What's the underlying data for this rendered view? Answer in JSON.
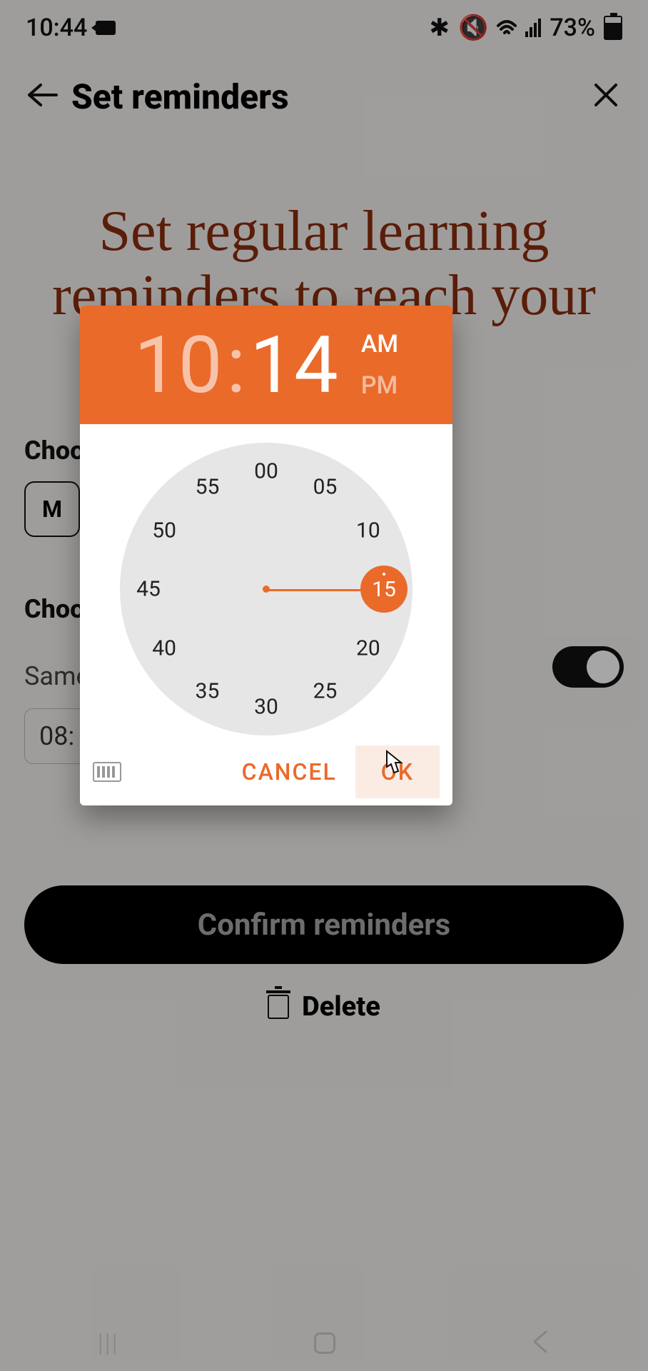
{
  "status": {
    "time": "10:44",
    "battery": "73%"
  },
  "appbar": {
    "title": "Set reminders"
  },
  "hero": "Set regular learning reminders to reach your",
  "form": {
    "chooseDays": "Choo",
    "dayChip": "M",
    "chooseTime": "Choo",
    "sameTime": "Same",
    "timeValue": "08:"
  },
  "buttons": {
    "confirm": "Confirm reminders",
    "delete": "Delete"
  },
  "picker": {
    "hour": "10",
    "minute": "14",
    "am": "AM",
    "pm": "PM",
    "period": "AM",
    "selectedMinute": 15,
    "minuteTicks": [
      "00",
      "05",
      "10",
      "15",
      "20",
      "25",
      "30",
      "35",
      "40",
      "45",
      "50",
      "55"
    ],
    "cancel": "CANCEL",
    "ok": "OK"
  },
  "colors": {
    "accent": "#ea6a2a"
  }
}
